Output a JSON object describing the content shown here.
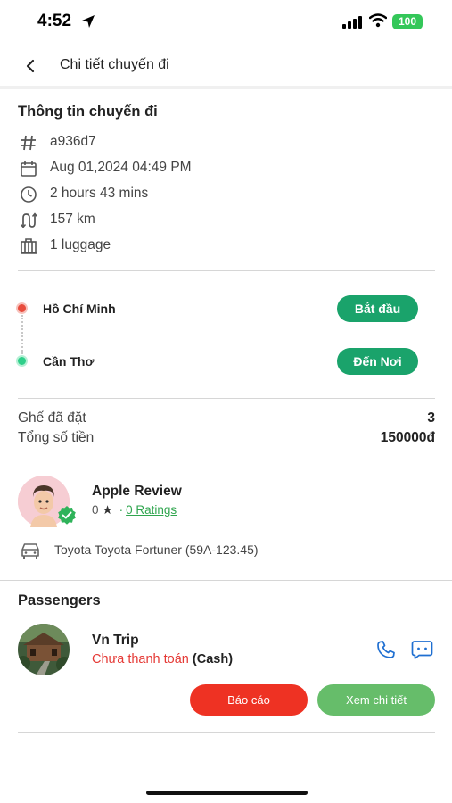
{
  "status_bar": {
    "time": "4:52",
    "battery": "100"
  },
  "nav": {
    "title": "Chi tiết chuyến đi"
  },
  "trip_info": {
    "title": "Thông tin chuyến đi",
    "rows": [
      {
        "icon": "hash-icon",
        "text": "a936d7"
      },
      {
        "icon": "calendar-icon",
        "text": "Aug 01,2024 04:49 PM"
      },
      {
        "icon": "clock-icon",
        "text": "2 hours 43 mins"
      },
      {
        "icon": "route-icon",
        "text": "157 km"
      },
      {
        "icon": "luggage-icon",
        "text": "1 luggage"
      }
    ]
  },
  "route": {
    "origin": {
      "label": "Hồ Chí Minh",
      "button": "Bắt đầu"
    },
    "destination": {
      "label": "Cần Thơ",
      "button": "Đến Nơi"
    }
  },
  "summary": {
    "seats_label": "Ghế đã đặt",
    "seats_value": "3",
    "total_label": "Tổng số tiền",
    "total_value": "150000đ"
  },
  "driver": {
    "name": "Apple Review",
    "rating": "0",
    "ratings_link": "0 Ratings",
    "vehicle": "Toyota Toyota Fortuner (59A-123.45)"
  },
  "passengers": {
    "title": "Passengers",
    "items": [
      {
        "name": "Vn Trip",
        "payment_status": "Chưa thanh toán",
        "payment_method": "(Cash)",
        "report_label": "Báo cáo",
        "detail_label": "Xem chi tiết"
      }
    ]
  },
  "colors": {
    "accent_green": "#1aa36b",
    "rating_green": "#2fa54e",
    "danger_red": "#ee3223",
    "unpaid_red": "#e53935",
    "icon_blue": "#1f6fd1"
  }
}
